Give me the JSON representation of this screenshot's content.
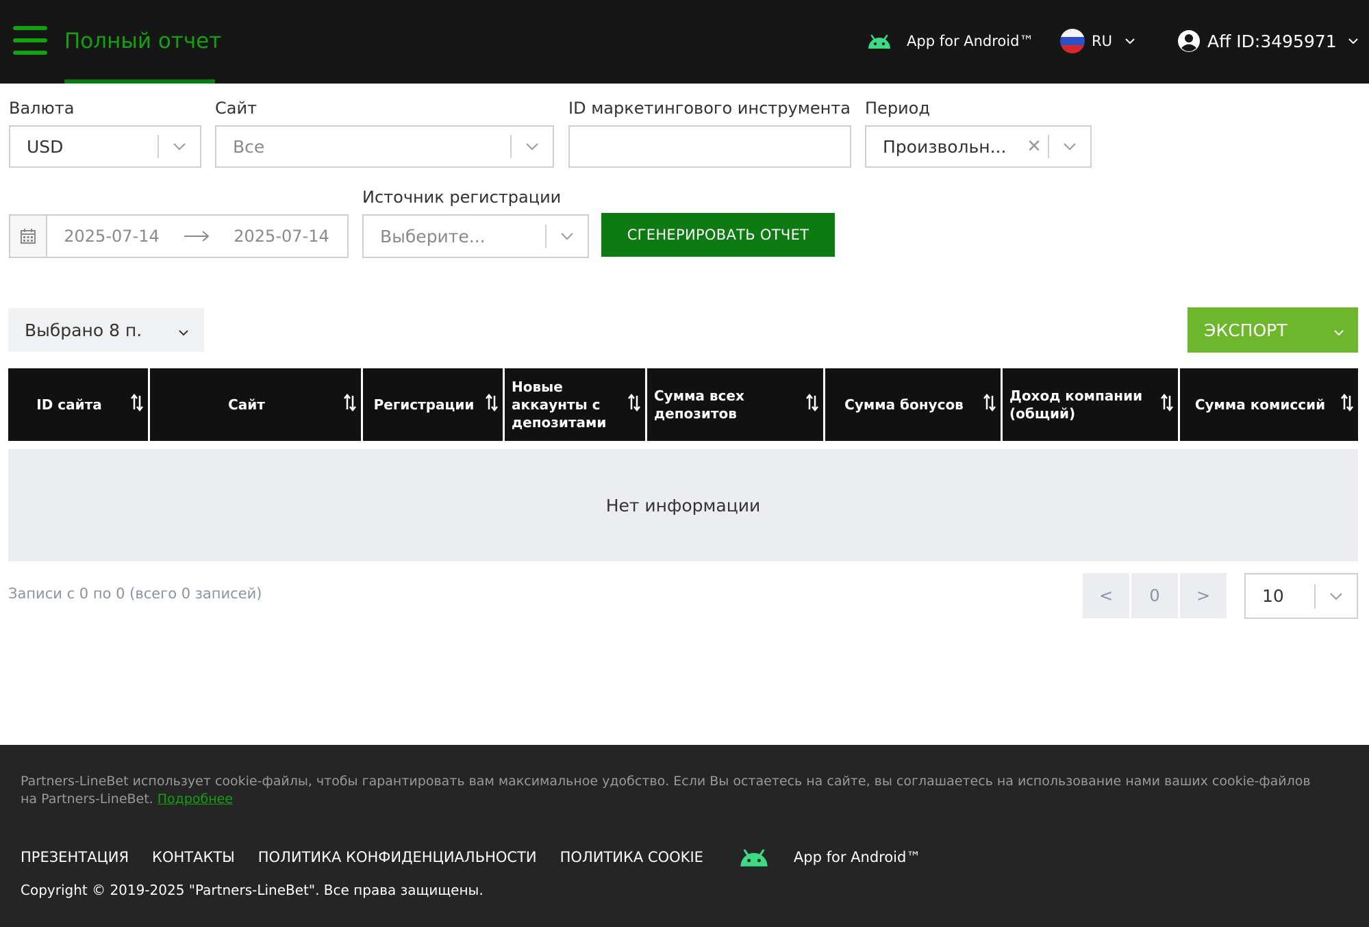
{
  "header": {
    "title": "Полный отчет",
    "android_label": "App for Android™",
    "language": "RU",
    "account_label": "Aff ID:3495971"
  },
  "filters": {
    "currency": {
      "label": "Валюта",
      "value": "USD"
    },
    "site": {
      "label": "Сайт",
      "value": "Все"
    },
    "marketing_id": {
      "label": "ID маркетингового инструмента",
      "value": ""
    },
    "period": {
      "label": "Период",
      "value": "Произвольн..."
    },
    "date_from": "2025-07-14",
    "date_to": "2025-07-14",
    "reg_source": {
      "label": "Источник регистрации",
      "placeholder": "Выберите..."
    },
    "generate_label": "СГЕНЕРИРОВАТЬ ОТЧЕТ"
  },
  "toolbar": {
    "columns_selected": "Выбрано 8 п.",
    "export_label": "ЭКСПОРТ"
  },
  "table": {
    "columns": [
      "ID сайта",
      "Сайт",
      "Регистрации",
      "Новые аккаунты с депозитами",
      "Сумма всех депозитов",
      "Сумма бонусов",
      "Доход компании (общий)",
      "Сумма комиссий"
    ],
    "empty_text": "Нет информации"
  },
  "pagination": {
    "records_text": "Записи с 0 по 0 (всего 0 записей)",
    "prev": "<",
    "current": "0",
    "next": ">",
    "page_size": "10"
  },
  "footer": {
    "cookie_text": "Partners-LineBet использует cookie-файлы, чтобы гарантировать вам максимальное удобство. Если Вы остаетесь на сайте, вы соглашаетесь на использование нами ваших cookie-файлов на Partners-LineBet. ",
    "cookie_link": "Подробнее",
    "links": [
      "ПРЕЗЕНТАЦИЯ",
      "КОНТАКТЫ",
      "ПОЛИТИКА КОНФИДЕНЦИАЛЬНОСТИ",
      "ПОЛИТИКА COOKIE"
    ],
    "android_label": "App for Android™",
    "copyright": "Copyright © 2019-2025 \"Partners-LineBet\". Все права защищены."
  },
  "colors": {
    "brand_green": "#13a10e",
    "button_green": "#0e7a12",
    "export_green": "#6cb72b",
    "header_bg": "#161616",
    "footer_bg": "#252525"
  },
  "icons": [
    "menu-icon",
    "android-icon",
    "flag-ru-icon",
    "chevron-down-icon",
    "user-icon",
    "calendar-icon",
    "arrow-right-icon",
    "clear-icon",
    "sort-icon"
  ]
}
